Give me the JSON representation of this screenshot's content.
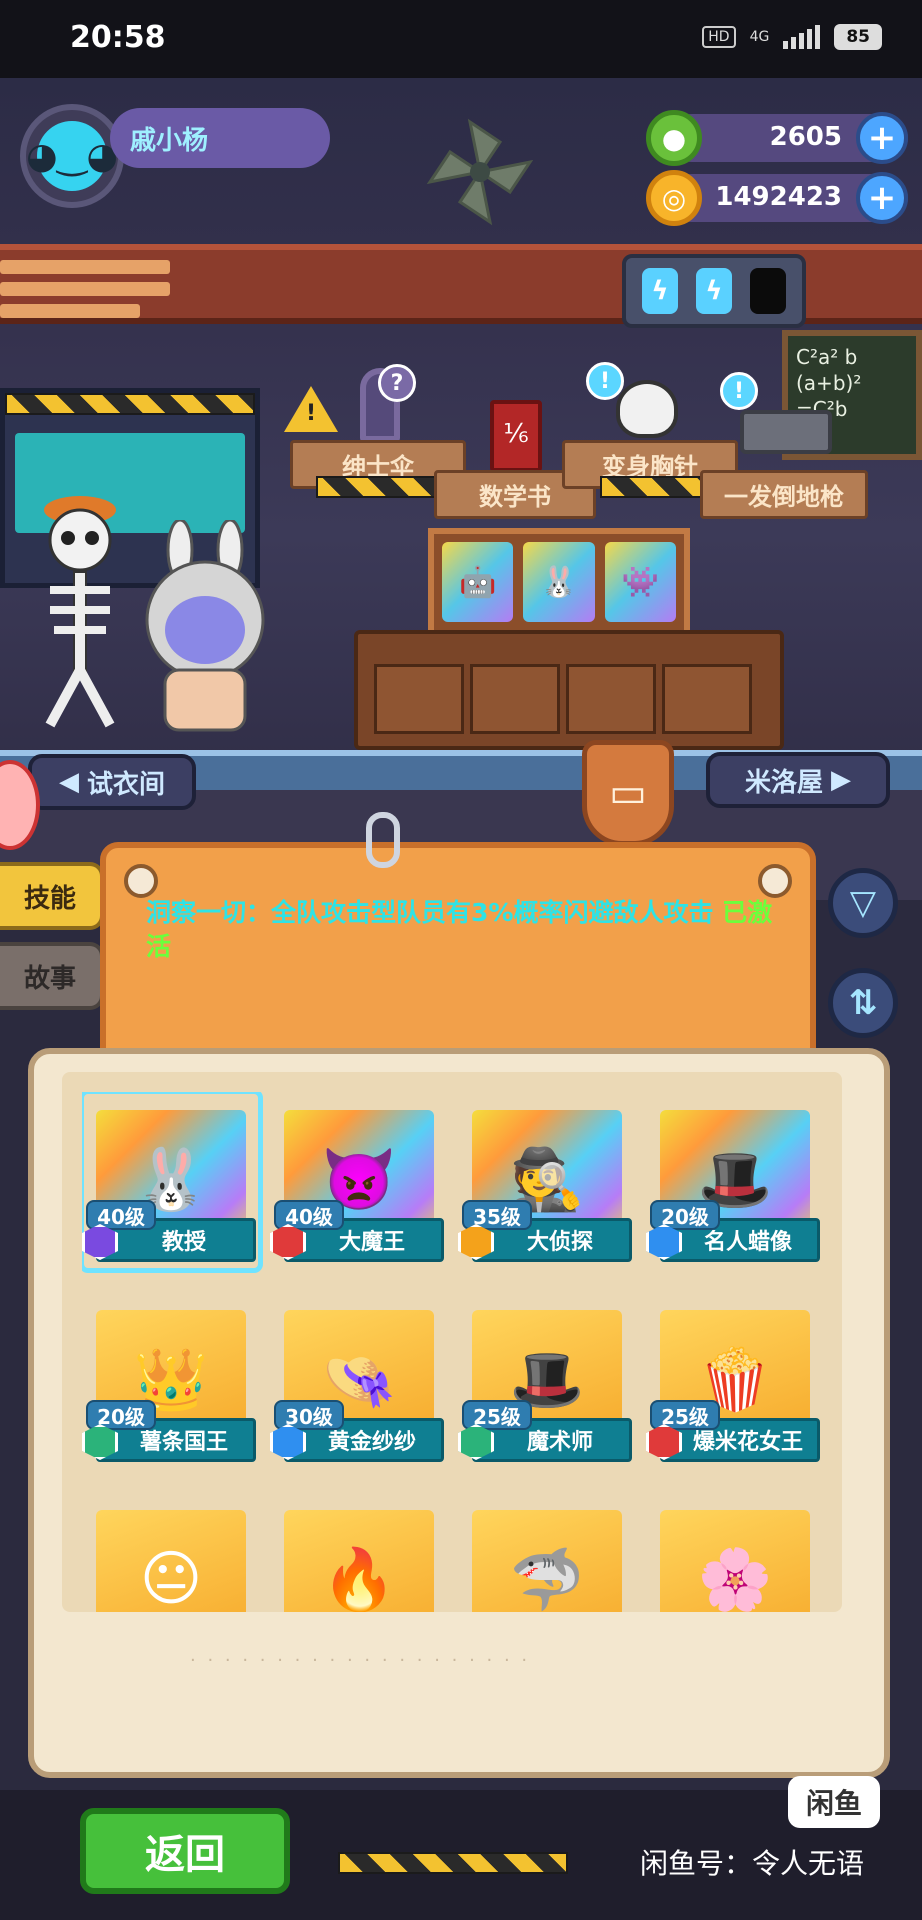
{
  "status_bar": {
    "time": "20:58",
    "hd": "HD",
    "network": "4G",
    "battery": "85"
  },
  "player": {
    "name": "戚小杨"
  },
  "currency": {
    "gems": "2605",
    "coins": "1492423",
    "plus_symbol": "+"
  },
  "items": {
    "umbrella": "绅士伞",
    "math_book": "数学书",
    "brooch": "变身胸针",
    "gun": "一发倒地枪",
    "warning_symbol": "!",
    "question_symbol": "?",
    "alert_symbol": "!"
  },
  "blackboard": {
    "line1": "C²a² b",
    "line2": "(a+b)²",
    "line3": "=C²b"
  },
  "nav": {
    "dressing_room": "试衣间",
    "mi_house": "米洛屋"
  },
  "side_tabs": {
    "skill": "技能",
    "story": "故事"
  },
  "skill": {
    "description": "洞察一切：全队攻击型队员有3%概率闪避敌人攻击",
    "status": "已激活"
  },
  "characters": [
    {
      "name": "教授",
      "level": "40级",
      "gem_color": "purple",
      "bg": "rainbow",
      "icon": "bunny-hood"
    },
    {
      "name": "大魔王",
      "level": "40级",
      "gem_color": "red",
      "bg": "rainbow",
      "icon": "demon-king"
    },
    {
      "name": "大侦探",
      "level": "35级",
      "gem_color": "orange",
      "bg": "rainbow",
      "icon": "detective"
    },
    {
      "name": "名人蜡像",
      "level": "20级",
      "gem_color": "blue",
      "bg": "rainbow",
      "icon": "wax-figure"
    },
    {
      "name": "薯条国王",
      "level": "20级",
      "gem_color": "green",
      "bg": "gold",
      "icon": "fries-king"
    },
    {
      "name": "黄金纱纱",
      "level": "30级",
      "gem_color": "blue",
      "bg": "gold",
      "icon": "golden-sasha"
    },
    {
      "name": "魔术师",
      "level": "25级",
      "gem_color": "green",
      "bg": "gold",
      "icon": "magician"
    },
    {
      "name": "爆米花女王",
      "level": "25级",
      "gem_color": "red",
      "bg": "gold",
      "icon": "popcorn-queen"
    },
    {
      "name": "",
      "level": "",
      "gem_color": "",
      "bg": "gold",
      "icon": "partial-1"
    },
    {
      "name": "",
      "level": "",
      "gem_color": "",
      "bg": "gold",
      "icon": "partial-2"
    },
    {
      "name": "",
      "level": "",
      "gem_color": "",
      "bg": "gold",
      "icon": "partial-3"
    },
    {
      "name": "",
      "level": "",
      "gem_color": "",
      "bg": "gold",
      "icon": "partial-4"
    }
  ],
  "footer": {
    "back": "返回"
  },
  "watermark": {
    "logo": "闲鱼",
    "text": "闲鱼号：令人无语"
  }
}
